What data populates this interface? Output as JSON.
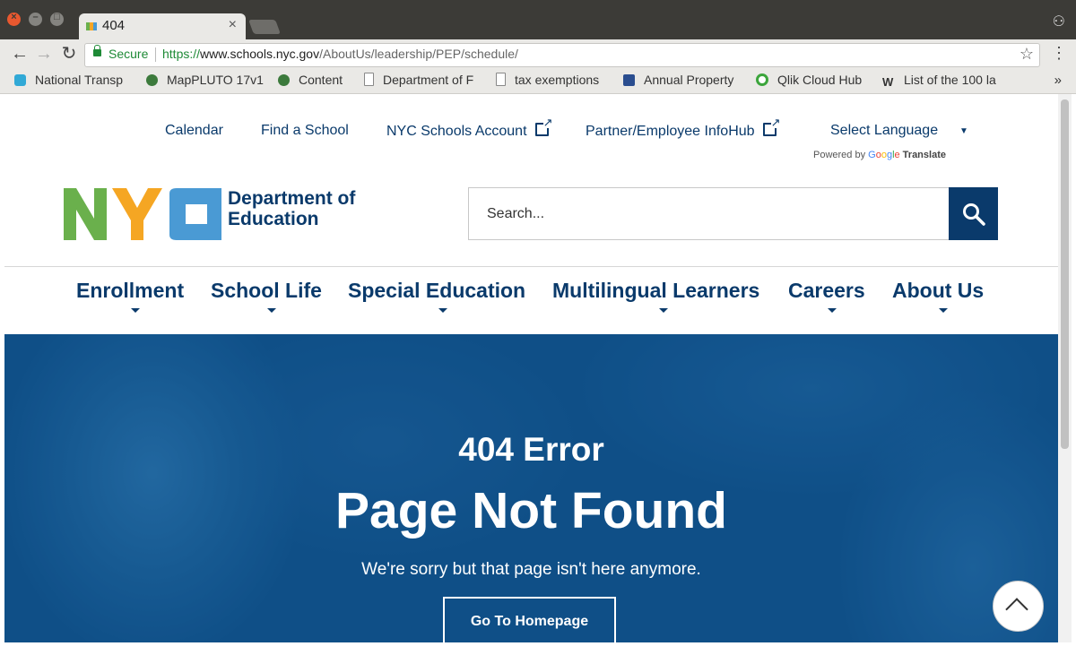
{
  "browser": {
    "tab_title": "404",
    "tab_close": "×",
    "secure_label": "Secure",
    "url_scheme": "https://",
    "url_host": "www.schools.nyc.gov",
    "url_path": "/AboutUs/leadership/PEP/schedule/",
    "bookmarks": [
      {
        "label": "National Transp",
        "icon_color": "#31a9d6"
      },
      {
        "label": "MapPLUTO 17v1",
        "icon_color": "#3c7a3c"
      },
      {
        "label": "Content",
        "icon_color": "#3c7a3c"
      },
      {
        "label": "Department of F",
        "icon_color": "#888888"
      },
      {
        "label": "tax exemptions",
        "icon_color": "#888888"
      },
      {
        "label": "Annual Property",
        "icon_color": "#2a4d8f"
      },
      {
        "label": "Qlik Cloud Hub",
        "icon_color": "#3ca53c"
      },
      {
        "label": "List of the 100 la",
        "icon_color": "#333333"
      }
    ],
    "bookmarks_more": "»"
  },
  "header": {
    "utility_links": {
      "calendar": "Calendar",
      "find_school": "Find a School",
      "schools_account": "NYC Schools Account",
      "infohub": "Partner/Employee InfoHub"
    },
    "language_select": "Select Language",
    "powered_by": "Powered by",
    "google": "Google",
    "translate": "Translate",
    "logo_line1": "Department of",
    "logo_line2": "Education",
    "logo_letters": "NYC",
    "search_placeholder": "Search..."
  },
  "nav": {
    "enrollment": "Enrollment",
    "school_life": "School Life",
    "special_education": "Special Education",
    "multilingual": "Multilingual Learners",
    "careers": "Careers",
    "about": "About Us"
  },
  "hero": {
    "code": "404 Error",
    "title": "Page Not Found",
    "message": "We're sorry but that page isn't here anymore.",
    "button": "Go To Homepage"
  },
  "colors": {
    "brand_navy": "#0a3a6b",
    "logo_green": "#6ab04c",
    "logo_orange": "#f5a623",
    "logo_blue": "#4a9ad4",
    "hero_blue": "#135a96"
  }
}
